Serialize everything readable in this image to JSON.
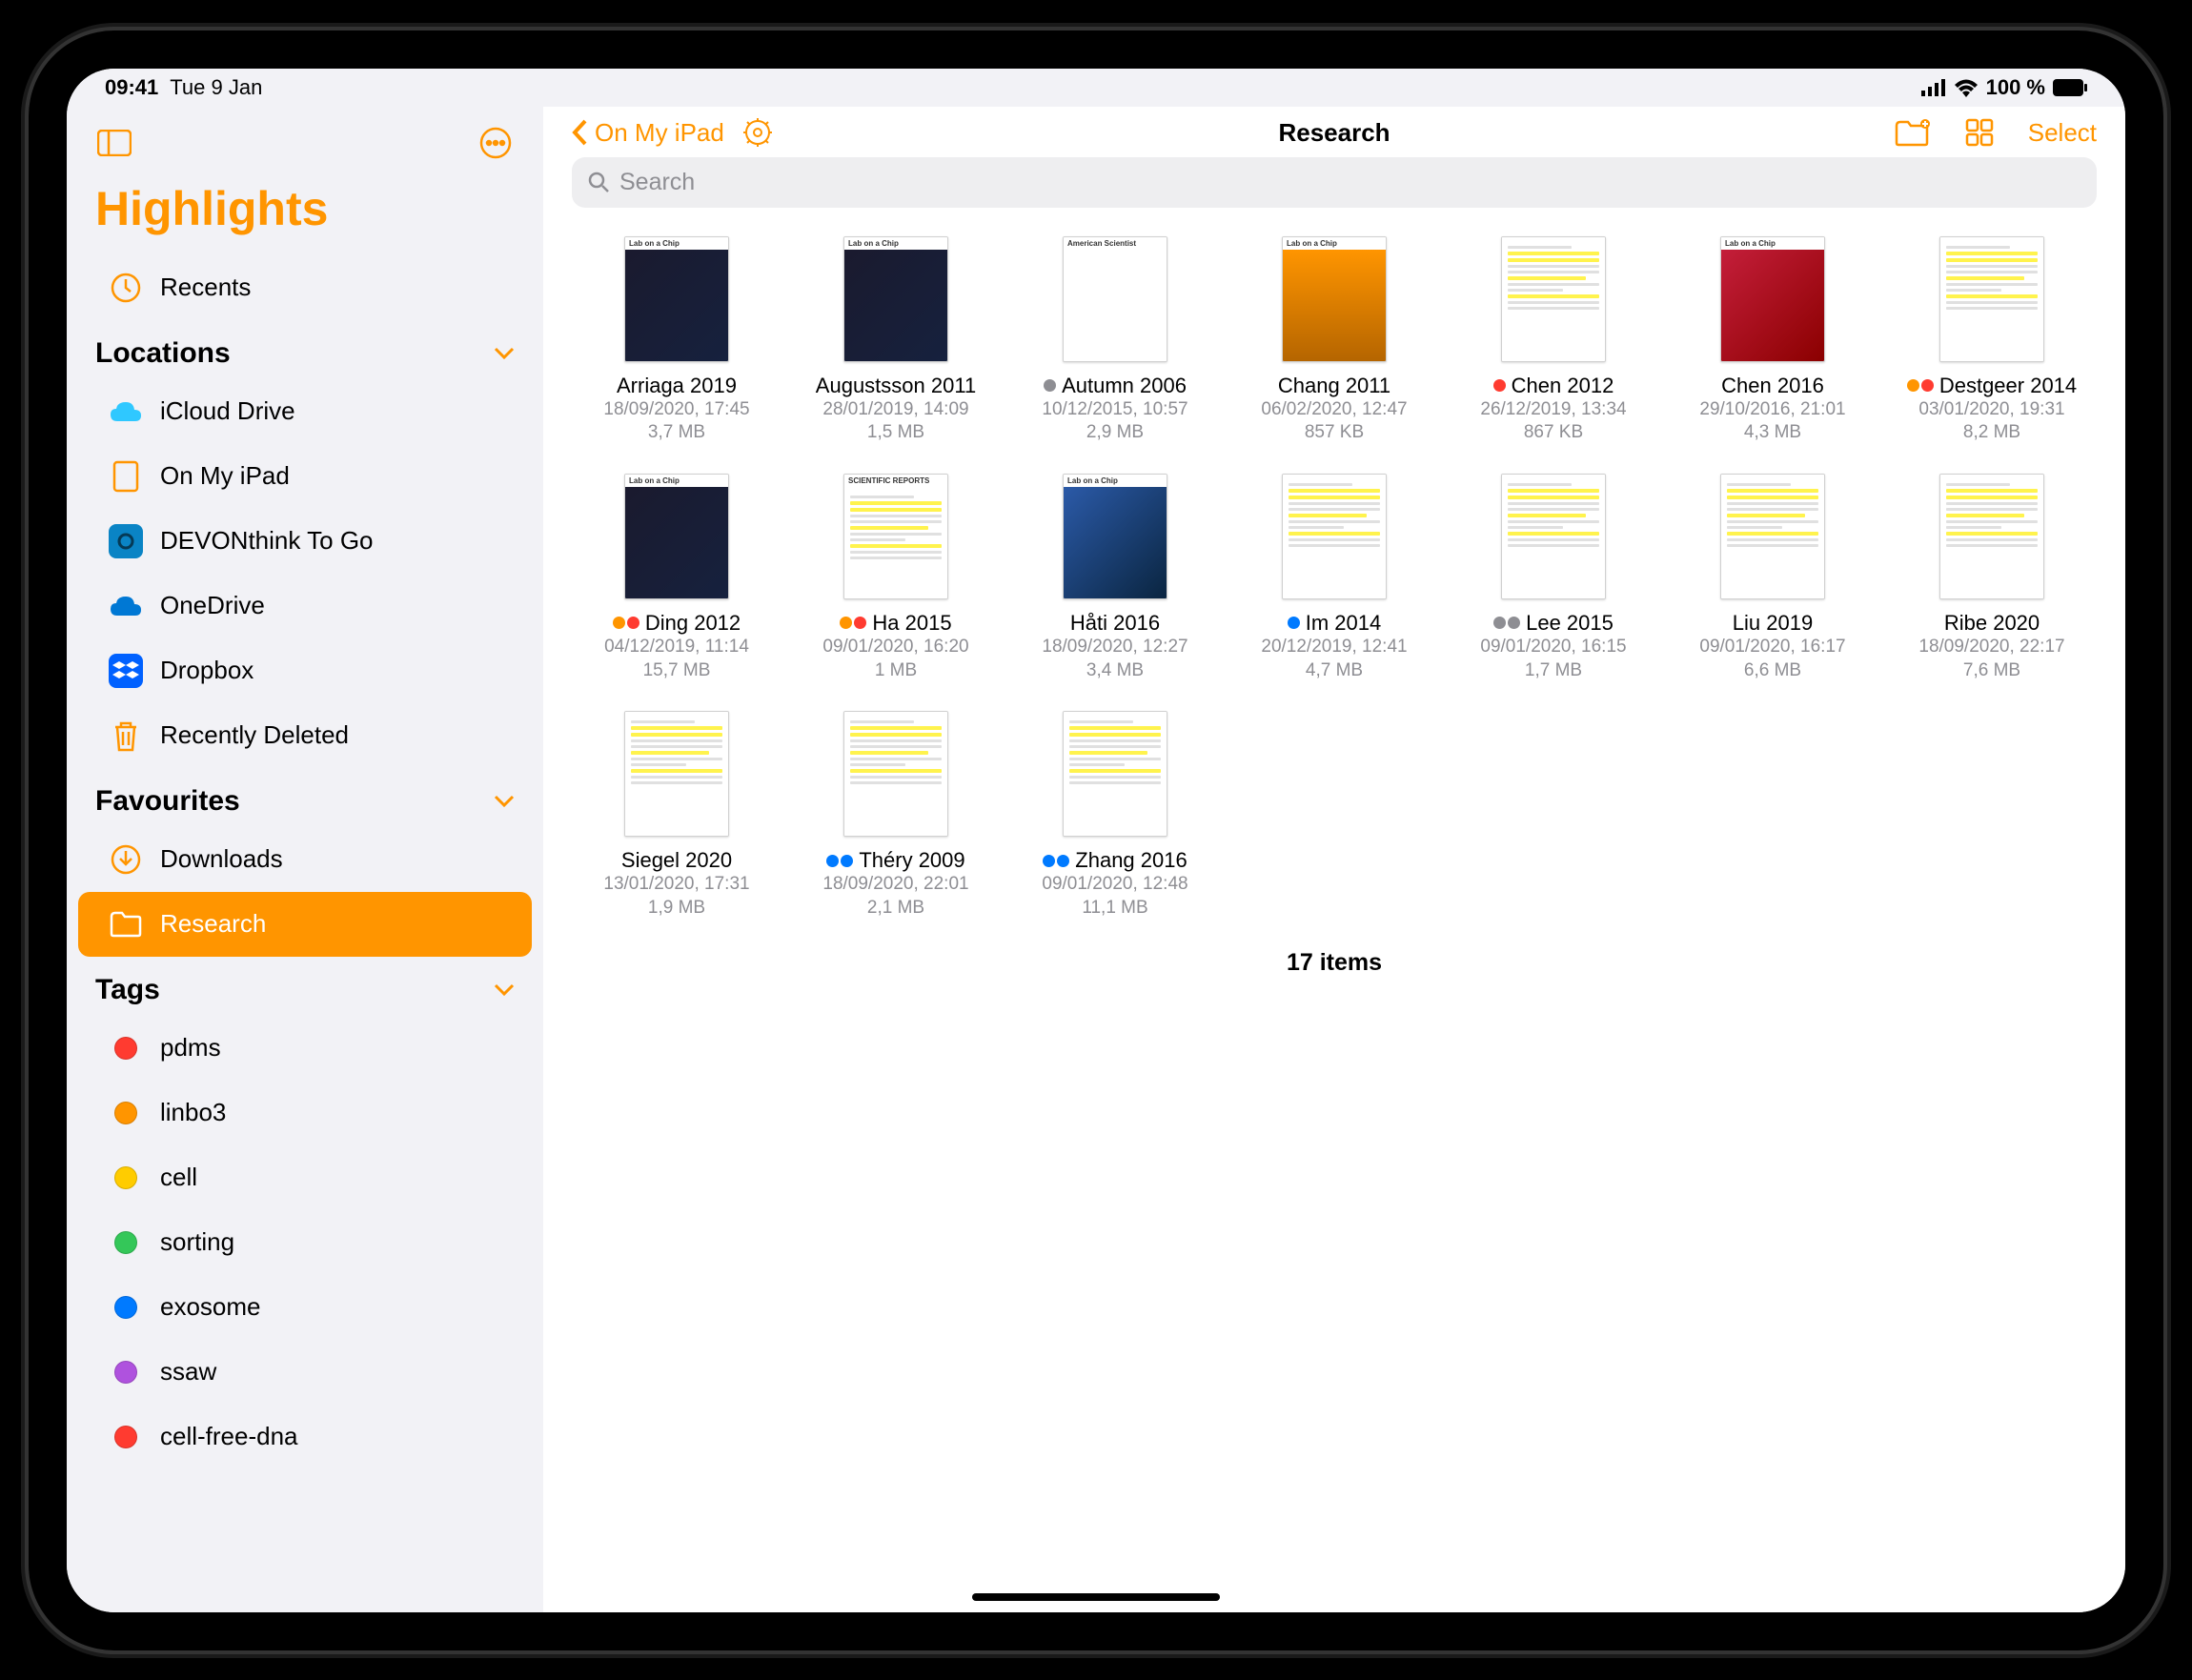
{
  "status": {
    "time": "09:41",
    "date": "Tue 9 Jan",
    "battery": "100 %"
  },
  "sidebar": {
    "app_title": "Highlights",
    "recents_label": "Recents",
    "locations_header": "Locations",
    "locations": [
      {
        "label": "iCloud Drive"
      },
      {
        "label": "On My iPad"
      },
      {
        "label": "DEVONthink To Go"
      },
      {
        "label": "OneDrive"
      },
      {
        "label": "Dropbox"
      },
      {
        "label": "Recently Deleted"
      }
    ],
    "favourites_header": "Favourites",
    "favourites": [
      {
        "label": "Downloads"
      },
      {
        "label": "Research"
      }
    ],
    "tags_header": "Tags",
    "tags": [
      {
        "label": "pdms",
        "color": "#ff3b30"
      },
      {
        "label": "linbo3",
        "color": "#ff9500"
      },
      {
        "label": "cell",
        "color": "#ffcc00"
      },
      {
        "label": "sorting",
        "color": "#34c759"
      },
      {
        "label": "exosome",
        "color": "#007aff"
      },
      {
        "label": "ssaw",
        "color": "#af52de"
      },
      {
        "label": "cell-free-dna",
        "color": "#ff3b30"
      }
    ]
  },
  "header": {
    "back_label": "On My iPad",
    "title": "Research",
    "select_label": "Select",
    "search_placeholder": "Search"
  },
  "files": [
    {
      "name": "Arriaga 2019",
      "date": "18/09/2020, 17:45",
      "size": "3,7 MB",
      "thumb_label": "Lab on a Chip",
      "thumb_style": "cover-dark",
      "dots": []
    },
    {
      "name": "Augustsson 2011",
      "date": "28/01/2019, 14:09",
      "size": "1,5 MB",
      "thumb_label": "Lab on a Chip",
      "thumb_style": "cover-dark",
      "dots": []
    },
    {
      "name": "Autumn 2006",
      "date": "10/12/2015, 10:57",
      "size": "2,9 MB",
      "thumb_label": "American Scientist",
      "thumb_style": "cover-gecko",
      "dots": [
        "#8e8e93"
      ]
    },
    {
      "name": "Chang 2011",
      "date": "06/02/2020, 12:47",
      "size": "857 KB",
      "thumb_label": "Lab on a Chip",
      "thumb_style": "cover-orange",
      "dots": []
    },
    {
      "name": "Chen 2012",
      "date": "26/12/2019, 13:34",
      "size": "867 KB",
      "thumb_label": "",
      "thumb_style": "doc",
      "dots": [
        "#ff3b30"
      ]
    },
    {
      "name": "Chen 2016",
      "date": "29/10/2016, 21:01",
      "size": "4,3 MB",
      "thumb_label": "Lab on a Chip",
      "thumb_style": "cover-red",
      "dots": []
    },
    {
      "name": "Destgeer 2014",
      "date": "03/01/2020, 19:31",
      "size": "8,2 MB",
      "thumb_label": "",
      "thumb_style": "doc",
      "dots": [
        "#ff9500",
        "#ff3b30"
      ]
    },
    {
      "name": "Ding 2012",
      "date": "04/12/2019, 11:14",
      "size": "15,7 MB",
      "thumb_label": "Lab on a Chip",
      "thumb_style": "cover-dark",
      "dots": [
        "#ff9500",
        "#ff3b30"
      ]
    },
    {
      "name": "Ha 2015",
      "date": "09/01/2020, 16:20",
      "size": "1 MB",
      "thumb_label": "SCIENTIFIC REPORTS",
      "thumb_style": "doc",
      "dots": [
        "#ff9500",
        "#ff3b30"
      ]
    },
    {
      "name": "Håti 2016",
      "date": "18/09/2020, 12:27",
      "size": "3,4 MB",
      "thumb_label": "Lab on a Chip",
      "thumb_style": "cover-blue",
      "dots": []
    },
    {
      "name": "Im 2014",
      "date": "20/12/2019, 12:41",
      "size": "4,7 MB",
      "thumb_label": "",
      "thumb_style": "doc",
      "dots": [
        "#007aff"
      ]
    },
    {
      "name": "Lee 2015",
      "date": "09/01/2020, 16:15",
      "size": "1,7 MB",
      "thumb_label": "",
      "thumb_style": "doc",
      "dots": [
        "#8e8e93",
        "#8e8e93"
      ]
    },
    {
      "name": "Liu 2019",
      "date": "09/01/2020, 16:17",
      "size": "6,6 MB",
      "thumb_label": "",
      "thumb_style": "doc",
      "dots": []
    },
    {
      "name": "Ribe 2020",
      "date": "18/09/2020, 22:17",
      "size": "7,6 MB",
      "thumb_label": "",
      "thumb_style": "doc",
      "dots": []
    },
    {
      "name": "Siegel 2020",
      "date": "13/01/2020, 17:31",
      "size": "1,9 MB",
      "thumb_label": "",
      "thumb_style": "doc",
      "dots": []
    },
    {
      "name": "Théry 2009",
      "date": "18/09/2020, 22:01",
      "size": "2,1 MB",
      "thumb_label": "",
      "thumb_style": "doc",
      "dots": [
        "#007aff",
        "#007aff"
      ]
    },
    {
      "name": "Zhang 2016",
      "date": "09/01/2020, 12:48",
      "size": "11,1 MB",
      "thumb_label": "",
      "thumb_style": "doc",
      "dots": [
        "#007aff",
        "#007aff"
      ]
    }
  ],
  "footer": {
    "count": "17 items"
  }
}
